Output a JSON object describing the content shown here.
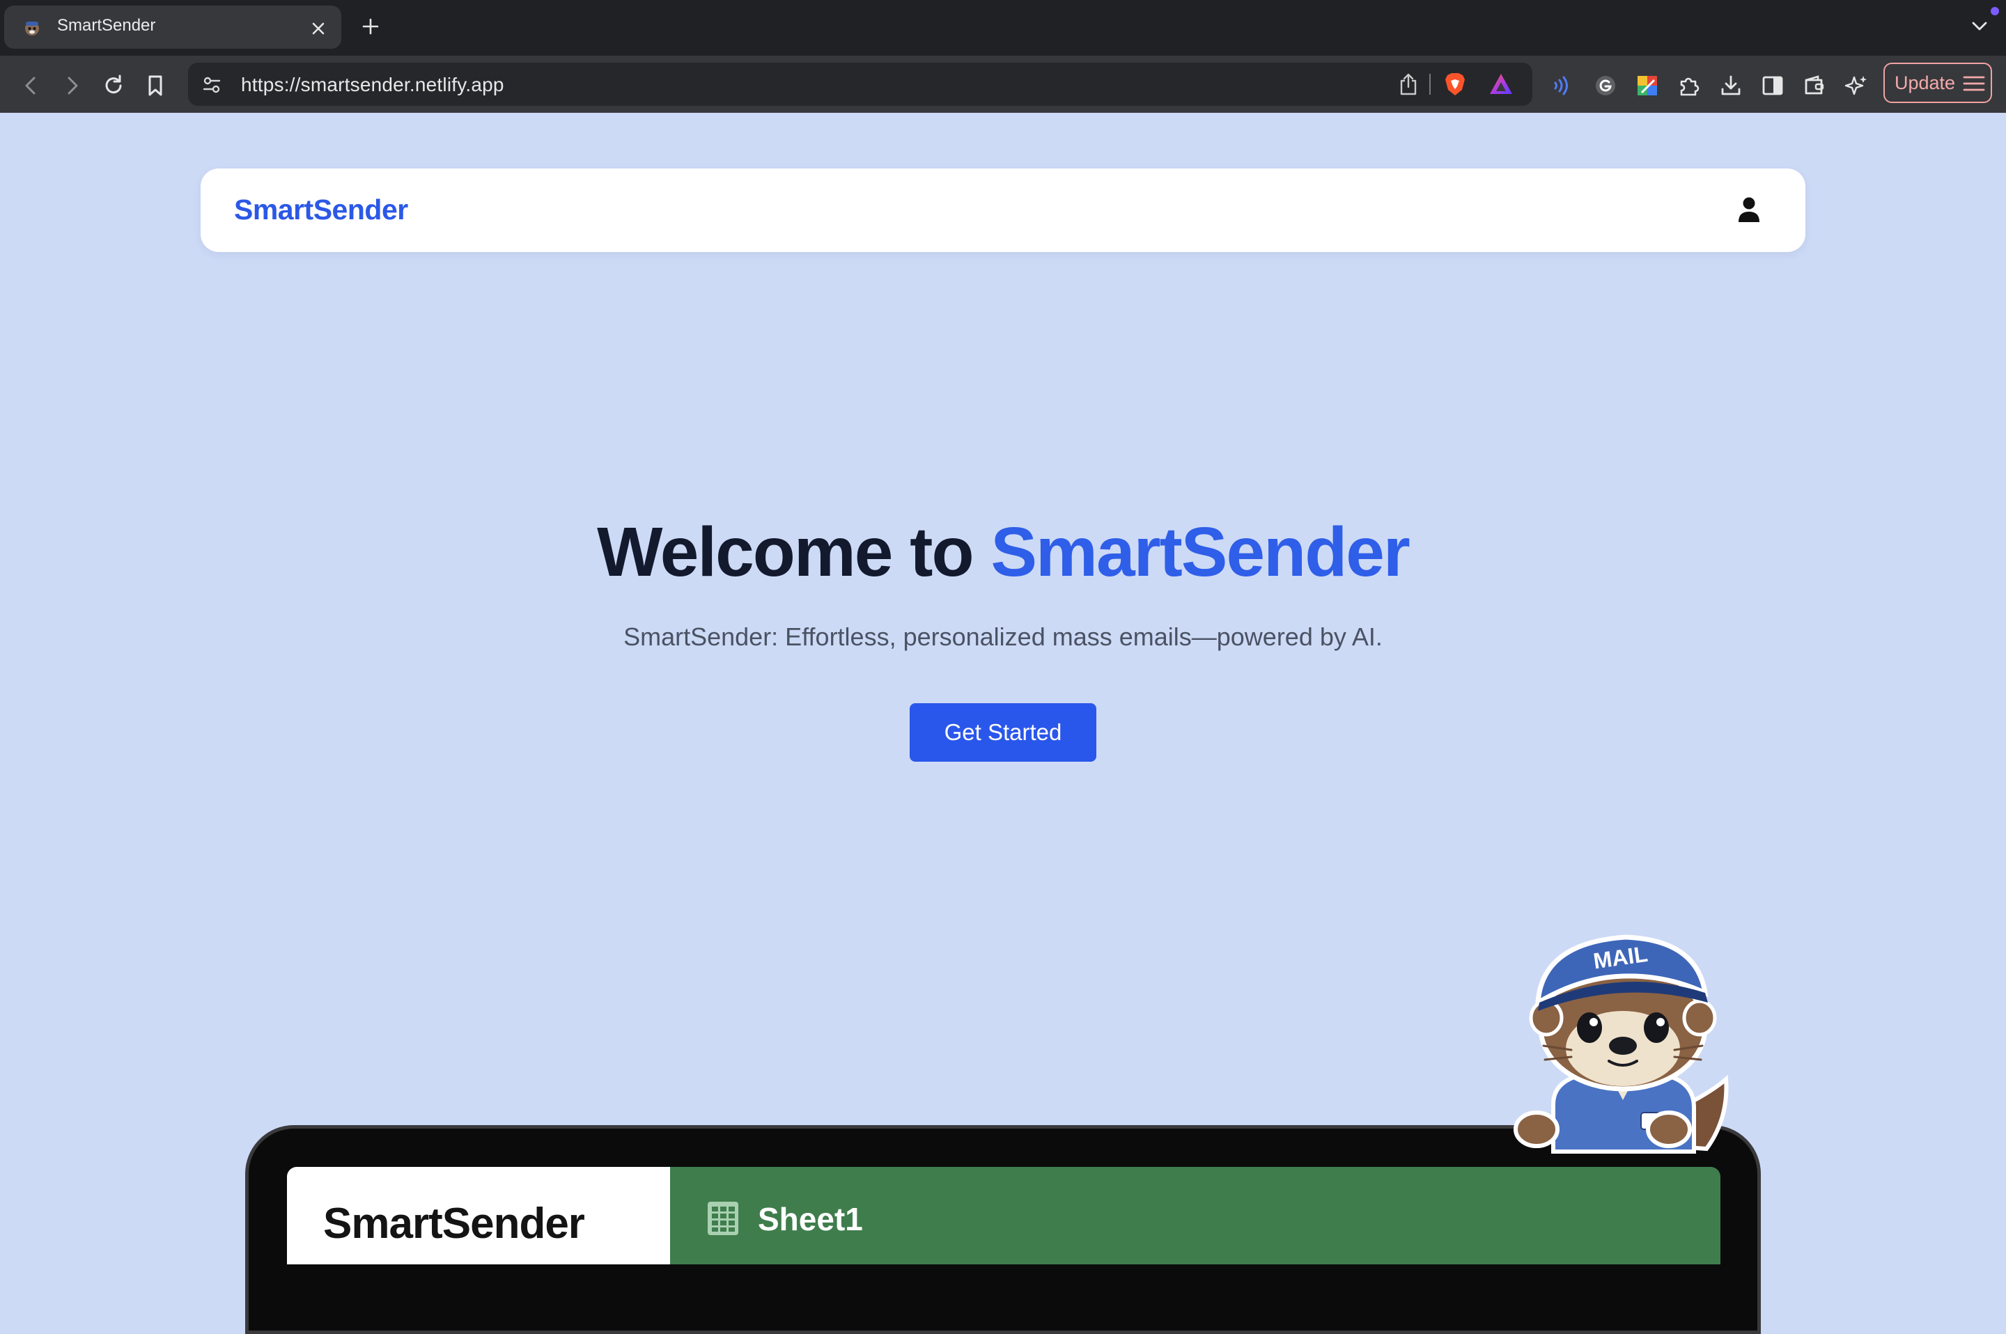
{
  "browser": {
    "tab_title": "SmartSender",
    "url": "https://smartsender.netlify.app",
    "update_label": "Update"
  },
  "nav": {
    "brand": "SmartSender"
  },
  "hero": {
    "title_prefix": "Welcome to ",
    "title_accent": "SmartSender",
    "subtitle": "SmartSender: Effortless, personalized mass emails—powered by AI.",
    "cta_label": "Get Started"
  },
  "preview": {
    "brand": "SmartSender",
    "sheet_name": "Sheet1"
  },
  "mascot": {
    "cap_text": "MAIL"
  },
  "colors": {
    "page_bg": "#cddaf6",
    "accent": "#2f5ee8",
    "button": "#2a57eb",
    "sheet_green": "#3f7d4c"
  }
}
